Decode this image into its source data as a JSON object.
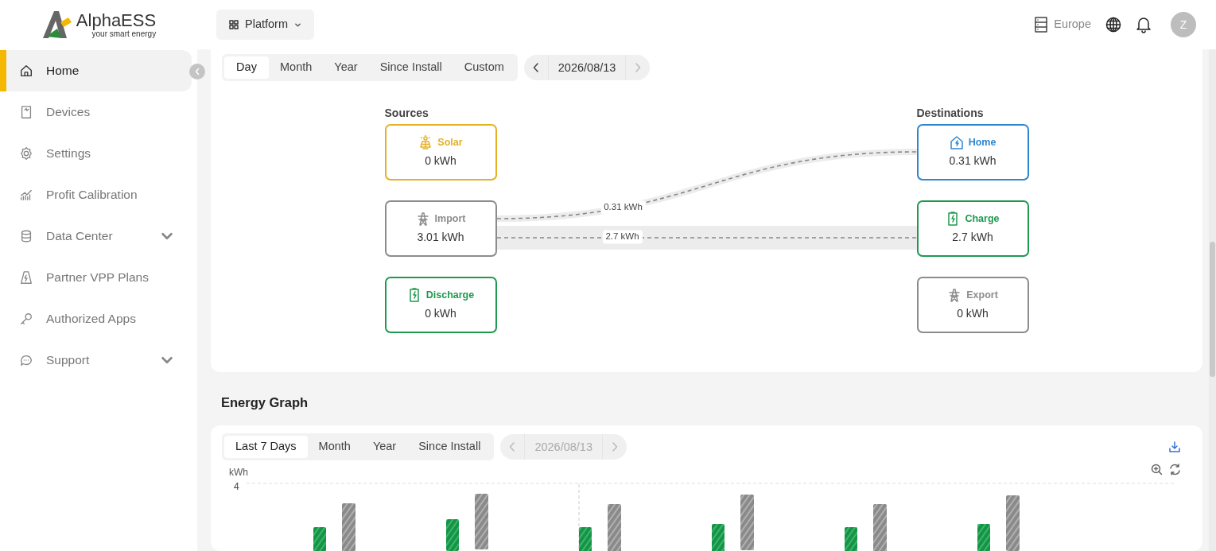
{
  "logo": {
    "name": "AlphaESS",
    "tagline": "your smart energy"
  },
  "sidebar": {
    "items": [
      {
        "kind": "home",
        "label": "Home",
        "selected": true,
        "expandable": false
      },
      {
        "kind": "devices",
        "label": "Devices",
        "selected": false,
        "expandable": false
      },
      {
        "kind": "settings",
        "label": "Settings",
        "selected": false,
        "expandable": false
      },
      {
        "kind": "profit",
        "label": "Profit Calibration",
        "selected": false,
        "expandable": false
      },
      {
        "kind": "data",
        "label": "Data Center",
        "selected": false,
        "expandable": true
      },
      {
        "kind": "vpp",
        "label": "Partner VPP Plans",
        "selected": false,
        "expandable": false
      },
      {
        "kind": "apps",
        "label": "Authorized Apps",
        "selected": false,
        "expandable": false
      },
      {
        "kind": "support",
        "label": "Support",
        "selected": false,
        "expandable": true
      }
    ]
  },
  "topbar": {
    "platform_menu": "Platform",
    "region": "Europe",
    "avatar_initial": "Z"
  },
  "energy_flow": {
    "tabs": [
      {
        "label": "Day",
        "selected": true
      },
      {
        "label": "Month",
        "selected": false
      },
      {
        "label": "Year",
        "selected": false
      },
      {
        "label": "Since Install",
        "selected": false
      },
      {
        "label": "Custom",
        "selected": false
      }
    ],
    "date": "2026/08/13",
    "date_disabled": false,
    "sources_title": "Sources",
    "destinations_title": "Destinations",
    "sources": [
      {
        "kind": "solar",
        "label": "Solar",
        "value": "0 kWh",
        "color": "#e5b022"
      },
      {
        "kind": "grid",
        "label": "Import",
        "value": "3.01 kWh",
        "color": "#8c8c8c"
      },
      {
        "kind": "battery",
        "label": "Discharge",
        "value": "0 kWh",
        "color": "#1e9a4f"
      }
    ],
    "destinations": [
      {
        "kind": "home",
        "label": "Home",
        "value": "0.31 kWh",
        "color": "#2f86d0"
      },
      {
        "kind": "battery",
        "label": "Charge",
        "value": "2.7 kWh",
        "color": "#1e9a4f"
      },
      {
        "kind": "grid",
        "label": "Export",
        "value": "0 kWh",
        "color": "#8c8c8c"
      }
    ],
    "flows": [
      {
        "kind": "curve",
        "label": "0.31 kWh"
      },
      {
        "kind": "straight",
        "label": "2.7 kWh"
      }
    ]
  },
  "energy_graph": {
    "title": "Energy Graph",
    "tabs": [
      {
        "label": "Last 7 Days",
        "selected": true
      },
      {
        "label": "Month",
        "selected": false
      },
      {
        "label": "Year",
        "selected": false
      },
      {
        "label": "Since Install",
        "selected": false
      }
    ],
    "date": "2026/08/13",
    "date_disabled": true,
    "y_unit": "kWh",
    "y_tick": "4"
  }
}
